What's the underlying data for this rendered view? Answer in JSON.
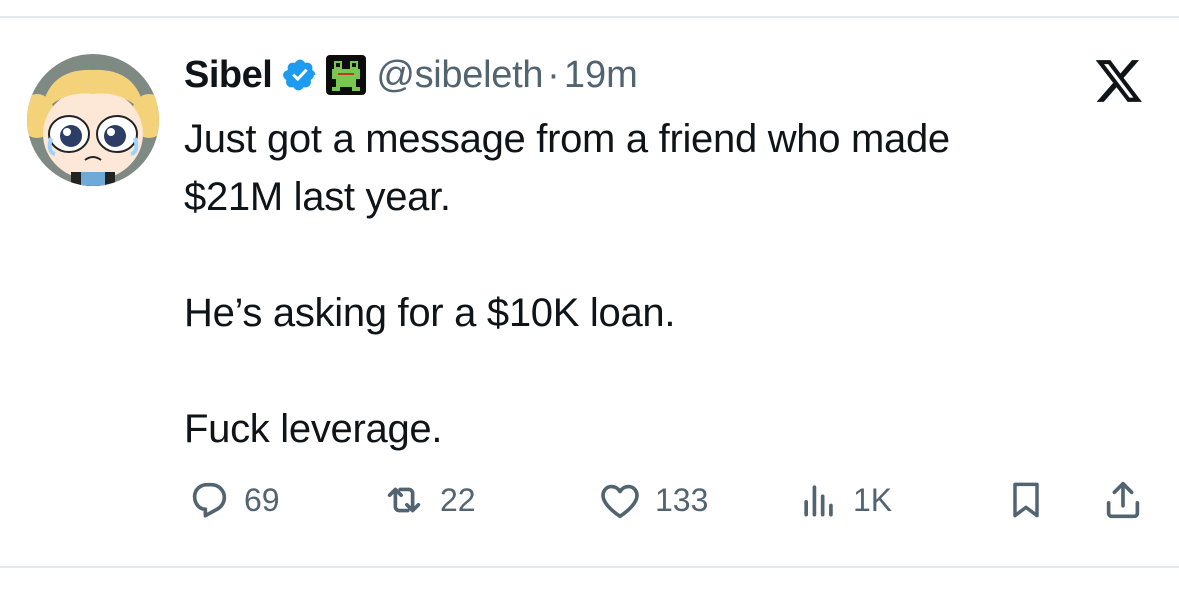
{
  "tweet": {
    "author_name": "Sibel",
    "handle": "@sibeleth",
    "separator": "·",
    "timestamp": "19m",
    "text_lines": [
      "Just got a message from a friend who made",
      "$21M last year.",
      "He’s asking for a $10K loan.",
      "Fuck leverage."
    ]
  },
  "actions": {
    "replies": "69",
    "reposts": "22",
    "likes": "133",
    "views": "1K"
  },
  "icons": {
    "avatar": "powerpuff-bubbles-avatar",
    "verified": "verified-badge-icon",
    "affiliate": "frog-badge-icon",
    "logo": "x-logo-icon",
    "reply": "reply-icon",
    "repost": "repost-icon",
    "like": "heart-icon",
    "views": "views-icon",
    "bookmark": "bookmark-icon",
    "share": "share-icon"
  },
  "colors": {
    "text": "#0f1419",
    "secondary": "#536471",
    "verified": "#1d9bf0",
    "divider": "#e6e9ec"
  }
}
